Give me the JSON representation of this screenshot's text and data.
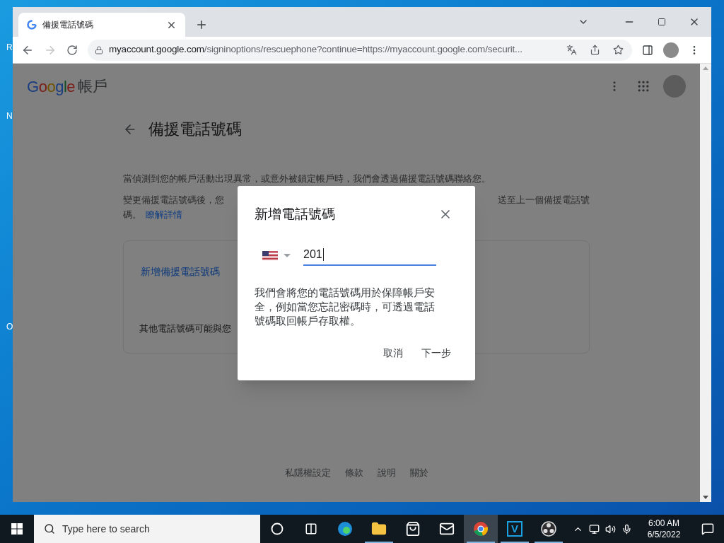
{
  "desktop": {
    "icon_labels": [
      "R",
      "N",
      "O"
    ]
  },
  "browser": {
    "tab": {
      "title": "備援電話號碼"
    },
    "forward_disabled": true,
    "url_host": "myaccount.google.com",
    "url_path": "/signinoptions/rescuephone?continue=https://myaccount.google.com/securit..."
  },
  "page": {
    "logo": "Google",
    "product": "帳戶",
    "title": "備援電話號碼",
    "paragraph_1": "當偵測到您的帳戶活動出現異常，或意外被鎖定帳戶時，我們會透過備援電話號碼聯絡您。",
    "paragraph_2_left": "變更備援電話號碼後，您",
    "paragraph_2_right": "送至上一個備援電話號",
    "paragraph_2_end": "碼。",
    "learn_more_link": "瞭解詳情",
    "card": {
      "add_link": "新增備援電話號碼",
      "note": "其他電話號碼可能與您"
    },
    "footer_links": [
      "私隱權設定",
      "條款",
      "說明",
      "關於"
    ]
  },
  "dialog": {
    "title": "新增電話號碼",
    "phone_field": {
      "value": "201",
      "focused": true
    },
    "description": "我們會將您的電話號碼用於保障帳戶安全，例如當您忘記密碼時，可透過電話號碼取回帳戶存取權。",
    "buttons": [
      "取消",
      "下一步"
    ]
  },
  "taskbar": {
    "search_placeholder": "Type here to search",
    "apps": [
      {
        "kind": "cortana",
        "running": false,
        "selected": false
      },
      {
        "kind": "task-view",
        "running": false,
        "selected": false
      },
      {
        "kind": "edge",
        "running": false,
        "selected": false
      },
      {
        "kind": "explorer",
        "running": true,
        "selected": false
      },
      {
        "kind": "store",
        "running": false,
        "selected": false
      },
      {
        "kind": "mail",
        "running": false,
        "selected": false
      },
      {
        "kind": "chrome",
        "running": true,
        "selected": true
      },
      {
        "kind": "letter",
        "label": "V",
        "running": true,
        "selected": false
      },
      {
        "kind": "obs",
        "running": true,
        "selected": false
      }
    ],
    "time": "6:00 AM",
    "date": "6/5/2022"
  }
}
